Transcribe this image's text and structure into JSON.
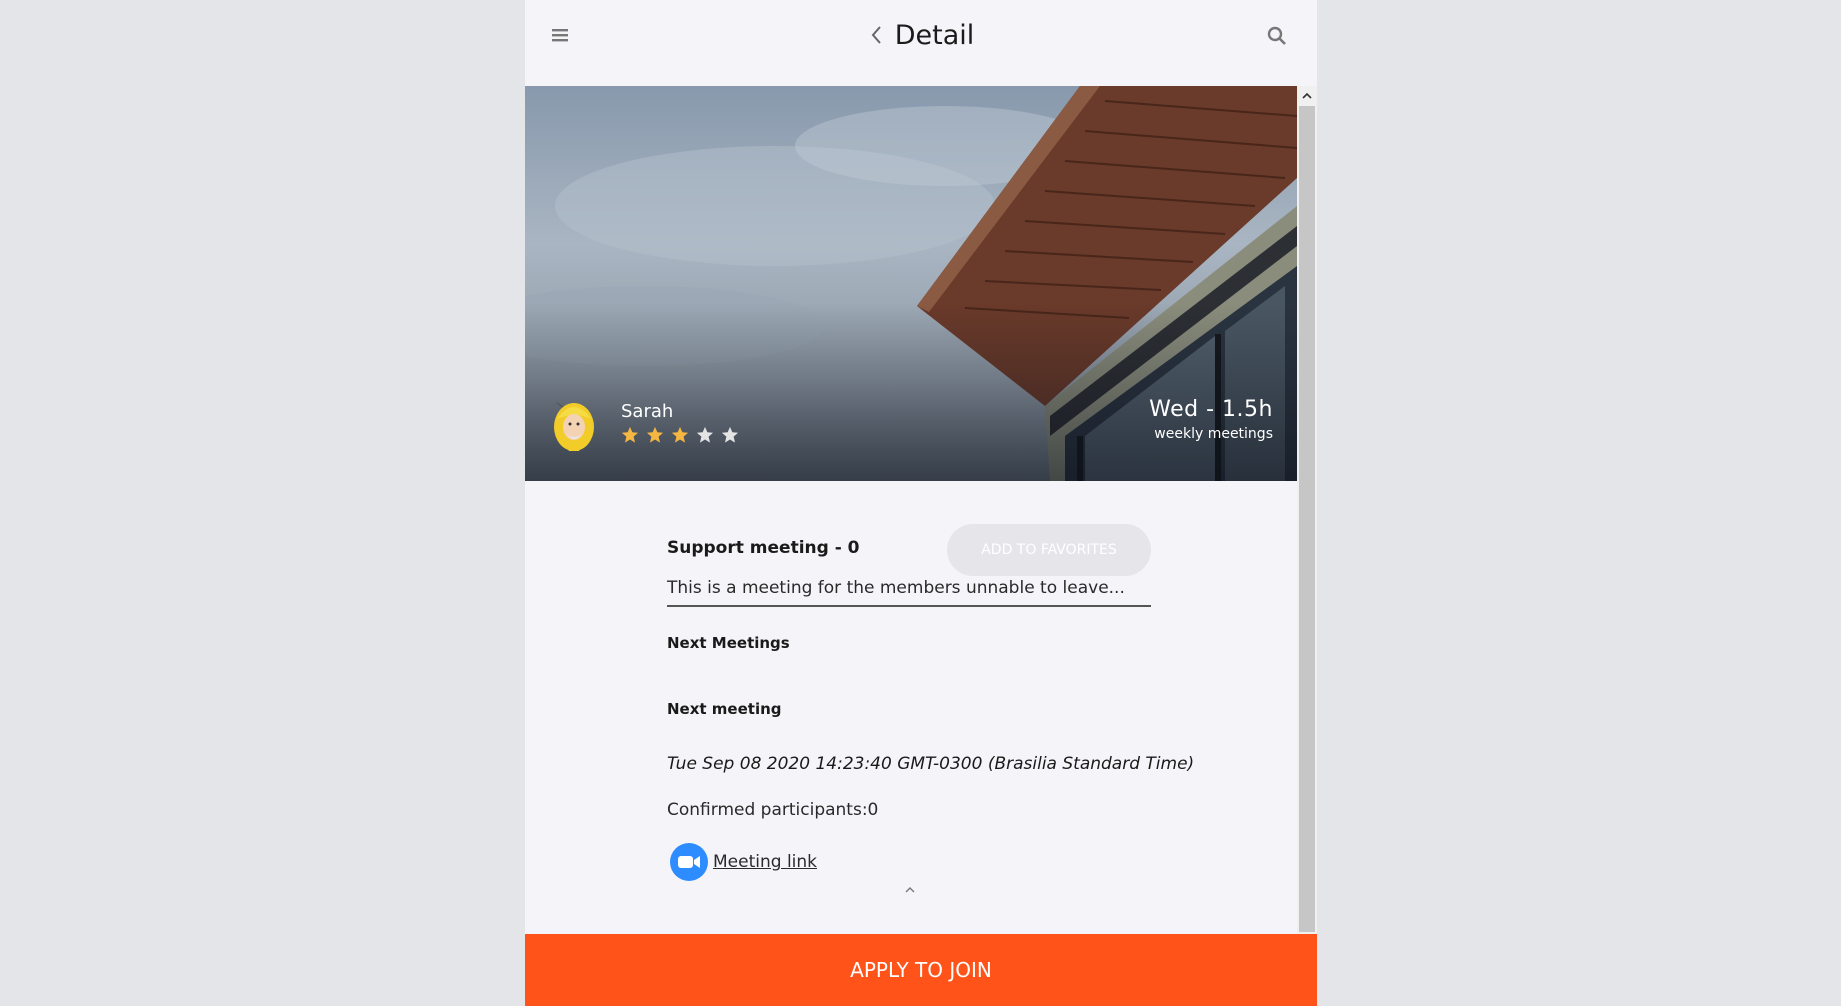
{
  "header": {
    "title": "Detail",
    "menu_icon": "hamburger-menu-icon",
    "back_icon": "chevron-left-icon",
    "search_icon": "search-icon"
  },
  "hero": {
    "host_name": "Sarah",
    "rating": 3,
    "rating_max": 5,
    "schedule": "Wed - 1.5h",
    "schedule_sub": "weekly meetings"
  },
  "meeting": {
    "title": "Support meeting - 0",
    "favorite_label": "ADD TO FAVORITES",
    "description": "This is a meeting for the members unnable to leave...",
    "next_meetings_heading": "Next Meetings",
    "next_meeting_heading": "Next meeting",
    "datetime": "Tue Sep 08 2020 14:23:40 GMT-0300 (Brasilia Standard Time)",
    "participants": "Confirmed participants:0",
    "link_label": "Meeting link"
  },
  "footer": {
    "apply_label": "APPLY TO JOIN"
  },
  "colors": {
    "accent": "#ff5319",
    "star_filled": "#f5b642",
    "star_empty": "#e4e4e4",
    "zoom_blue": "#2d8cff",
    "background": "#f5f4f8"
  }
}
